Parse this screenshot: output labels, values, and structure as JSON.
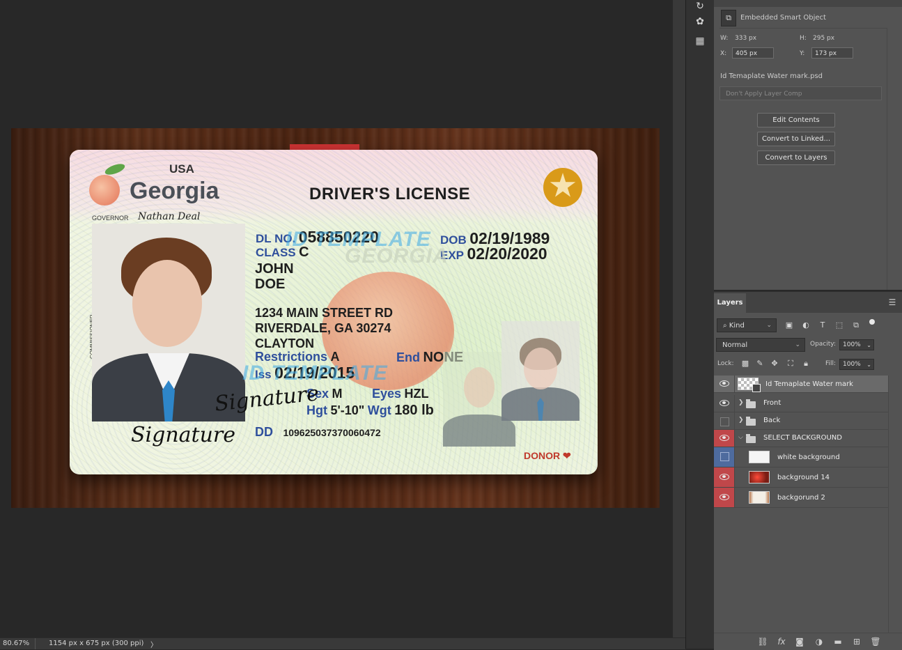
{
  "document": {
    "zoom": "80.67%",
    "info": "1154 px x 675 px (300 ppi)",
    "status_arrow": "〉"
  },
  "license": {
    "country": "USA",
    "state": "Georgia",
    "governor_label": "GOVERNOR",
    "governor_signature": "Nathan Deal",
    "title": "DRIVER'S LICENSE",
    "commissioner_label": "COMMISSIONER",
    "dl_label": "DL NO.",
    "dl_number": "058850220",
    "class_label": "CLASS",
    "class_value": "C",
    "dob_label": "DOB",
    "dob": "02/19/1989",
    "exp_label": "EXP",
    "exp": "02/20/2020",
    "first_name": "JOHN",
    "last_name": "DOE",
    "address_line1": "1234 MAIN STREET RD",
    "address_line2": "RIVERDALE, GA 30274",
    "county": "CLAYTON",
    "restrictions_label": "Restrictions",
    "restrictions_value": "A",
    "end_label": "End",
    "end_value": "NONE",
    "iss_label": "Iss",
    "iss_date": "02/19/2015",
    "sex_label": "Sex",
    "sex_value": "M",
    "eyes_label": "Eyes",
    "eyes_value": "HZL",
    "hgt_label": "Hgt",
    "hgt_value": "5'-10\"",
    "wgt_label": "Wgt",
    "wgt_value": "180 lb",
    "dd_label": "DD",
    "dd_value": "10962503737006047​2",
    "signature": "Signature",
    "watermark": "ID TEMPLATE",
    "watermark_state": "GEORGIA",
    "donor_label": "DONOR",
    "donor_heart": "❤"
  },
  "properties": {
    "type_label": "Embedded Smart Object",
    "w_label": "W:",
    "w_value": "333 px",
    "h_label": "H:",
    "h_value": "295 px",
    "x_label": "X:",
    "x_value": "405 px",
    "y_label": "Y:",
    "y_value": "173 px",
    "filename": "Id Temaplate Water mark.psd",
    "layer_comp_placeholder": "Don't Apply Layer Comp",
    "buttons": [
      "Edit Contents",
      "Convert to Linked...",
      "Convert to Layers"
    ]
  },
  "layers_panel": {
    "tab": "Layers",
    "filter_kind": "Kind",
    "blend_mode": "Normal",
    "opacity_label": "Opacity:",
    "opacity_value": "100%",
    "lock_label": "Lock:",
    "fill_label": "Fill:",
    "fill_value": "100%",
    "layers": [
      {
        "name": "Id Temaplate Water mark",
        "visible": true,
        "type": "smart",
        "selected": true
      },
      {
        "name": "Front",
        "visible": true,
        "type": "group"
      },
      {
        "name": "Back",
        "visible": false,
        "type": "group"
      },
      {
        "name": "SELECT BACKGROUND",
        "visible": true,
        "type": "group-open",
        "eye_color": "#c0474a"
      },
      {
        "name": "white background",
        "visible": false,
        "type": "pixel",
        "eye_color": "#4e6b9e",
        "thumb_color": "#f5f5f5"
      },
      {
        "name": "background 14",
        "visible": true,
        "type": "pixel",
        "eye_color": "#c0474a",
        "thumb_color": "#9a2a1c"
      },
      {
        "name": "backgorund 2",
        "visible": true,
        "type": "pixel",
        "eye_color": "#c0474a",
        "thumb_color": "#f4efe6"
      }
    ]
  },
  "colors": {
    "app_bg": "#282828",
    "panel_bg": "#535353",
    "eye_red": "#c0474a",
    "eye_blue": "#4e6b9e",
    "license_label_blue": "#2f4f9c",
    "badge_gold": "#d99a19"
  }
}
